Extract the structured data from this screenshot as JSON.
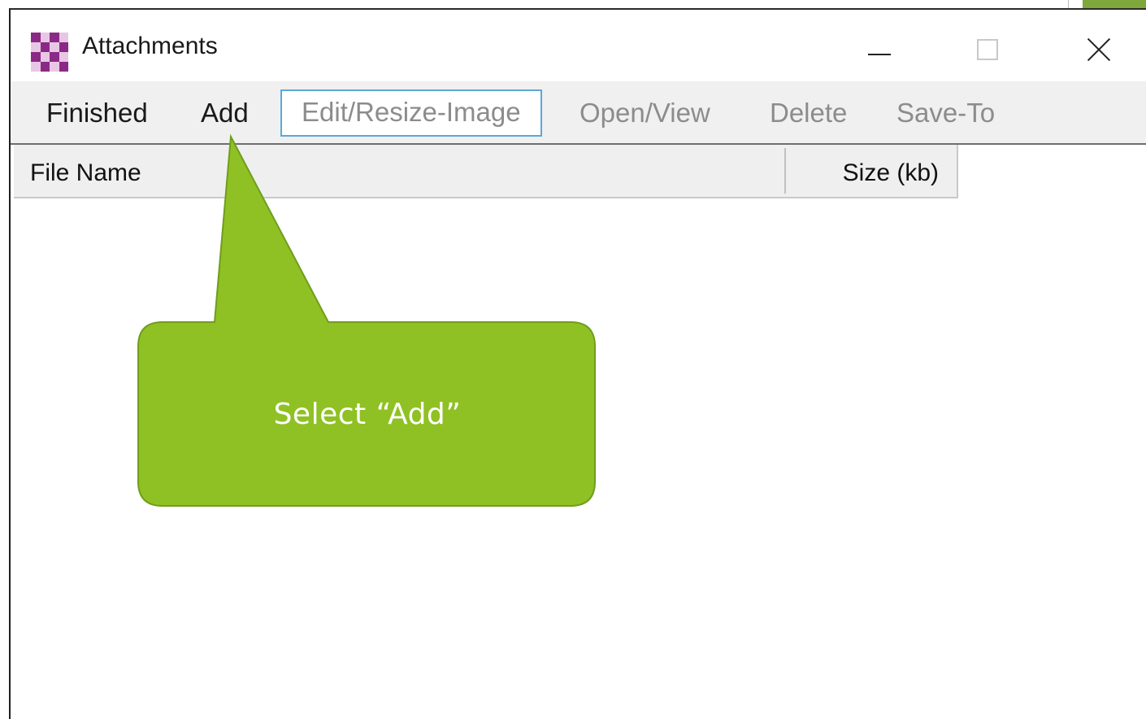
{
  "window": {
    "title": "Attachments"
  },
  "titlebar": {
    "minimize": "minimize-icon",
    "maximize": "maximize-icon",
    "close": "close-icon"
  },
  "menu": {
    "items": [
      {
        "label": "Finished",
        "state": "enabled"
      },
      {
        "label": "Add",
        "state": "enabled"
      },
      {
        "label": "Edit/Resize-Image",
        "state": "disabled-focused"
      },
      {
        "label": "Open/View",
        "state": "disabled"
      },
      {
        "label": "Delete",
        "state": "disabled"
      },
      {
        "label": "Save-To",
        "state": "disabled"
      }
    ]
  },
  "list": {
    "columns": [
      "File Name",
      "Size (kb)"
    ],
    "rows": []
  },
  "callout": {
    "text": "Select “Add”",
    "color": "#8fc124",
    "border_color": "#6f9e1c"
  }
}
